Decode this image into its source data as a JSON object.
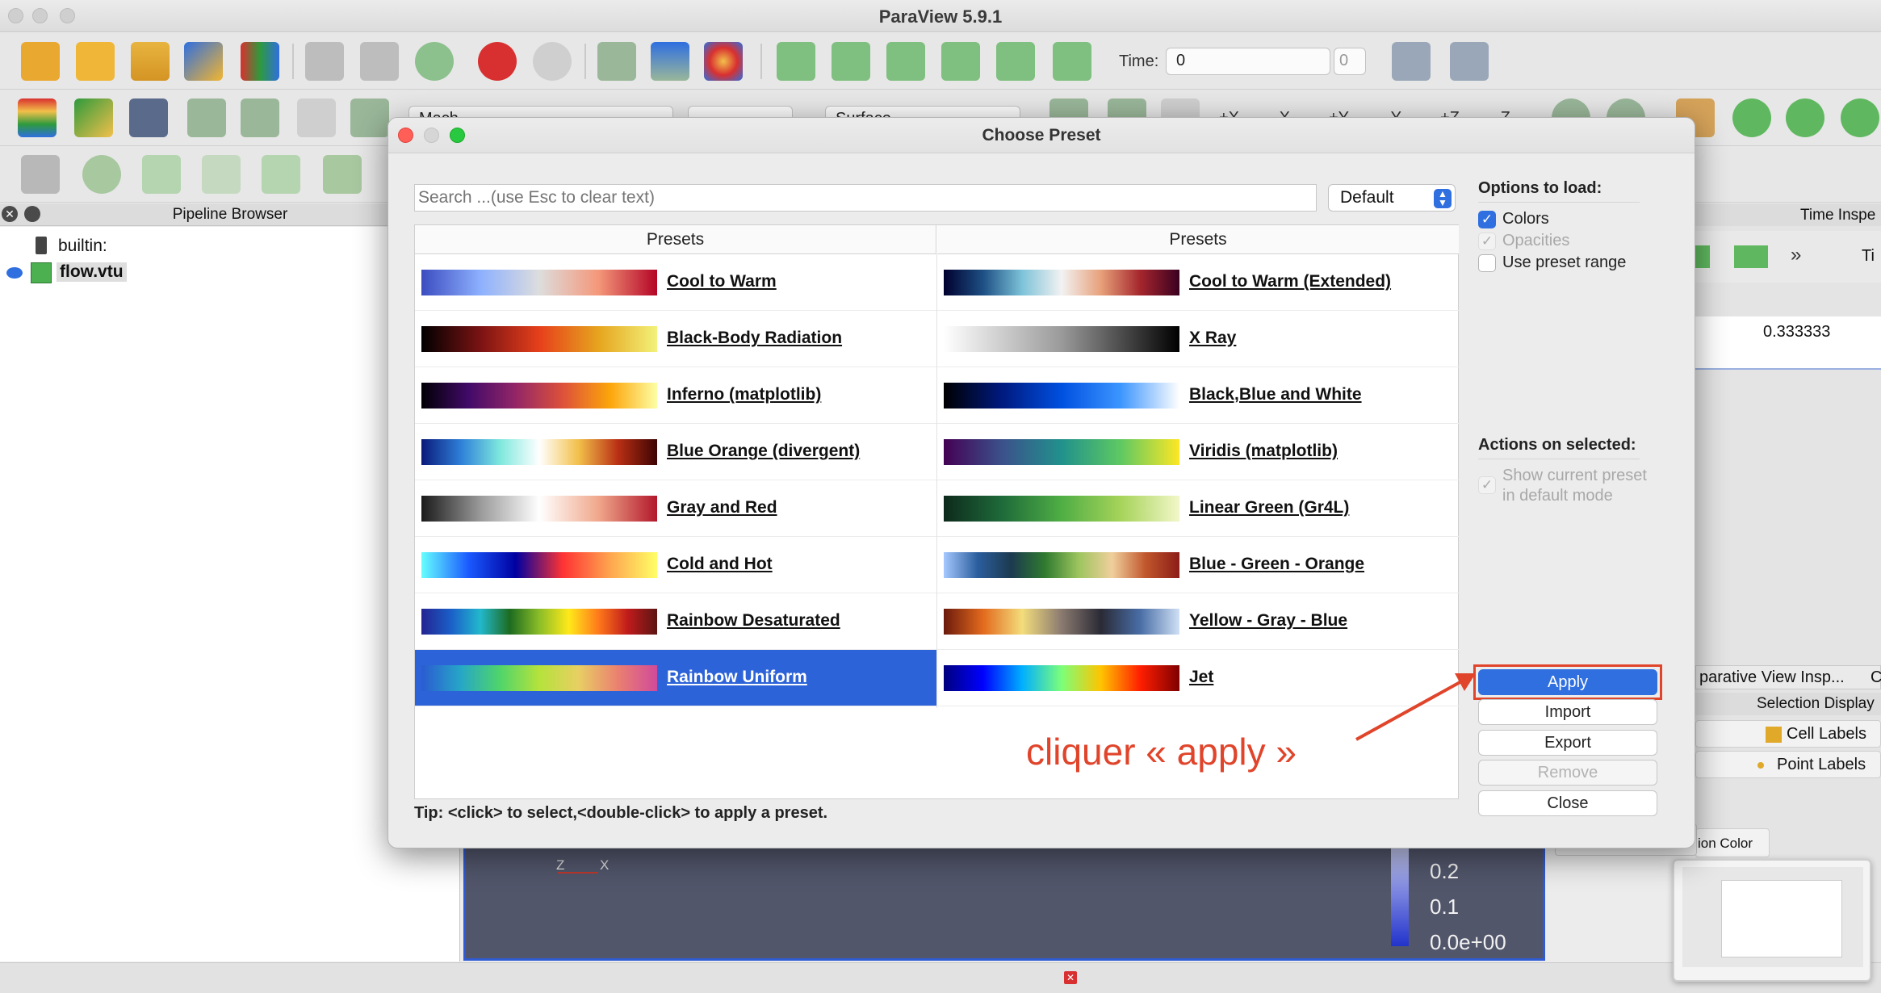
{
  "window": {
    "title": "ParaView 5.9.1"
  },
  "toolbar": {
    "time_label": "Time:",
    "time_value": "0",
    "time_index": "0",
    "array_combo": "Mach",
    "representation_combo": "Surface",
    "camera_labels": [
      "+X",
      "-X",
      "+Y",
      "-Y",
      "+Z",
      "-Z"
    ]
  },
  "pipeline": {
    "header": "Pipeline Browser",
    "items": [
      {
        "label": "builtin:"
      },
      {
        "label": "flow.vtu"
      }
    ]
  },
  "right_panel": {
    "time_inspector": "Time Inspe",
    "time_short": "Ti",
    "time_value": "0.333333",
    "comparative_tab": "parative View Insp...",
    "other_tab": "C",
    "selection_display": "Selection Display",
    "cell_labels": "Cell Labels",
    "point_labels": "Point Labels",
    "color_label": "ion Color"
  },
  "render_view": {
    "scalar_labels": [
      "0.2",
      "0.1",
      "0.0e+00"
    ],
    "axes_z": "Z",
    "axes_x": "X"
  },
  "dialog": {
    "title": "Choose Preset",
    "search_placeholder": "Search ...(use Esc to clear text)",
    "filter_value": "Default",
    "column_headers": [
      "Presets",
      "Presets"
    ],
    "left_presets": [
      {
        "name": "Cool to Warm",
        "colors": [
          "#3b4cc0",
          "#8db0fe",
          "#dddddd",
          "#f4987a",
          "#b40426"
        ]
      },
      {
        "name": "Black-Body Radiation",
        "colors": [
          "#000000",
          "#7a1313",
          "#e6401b",
          "#e6a41e",
          "#f2f27a"
        ]
      },
      {
        "name": "Inferno (matplotlib)",
        "colors": [
          "#000004",
          "#420a68",
          "#932667",
          "#dd513a",
          "#fca50a",
          "#fcffa4"
        ]
      },
      {
        "name": "Blue Orange (divergent)",
        "colors": [
          "#0a1a7a",
          "#2e7fd8",
          "#7ee8dd",
          "#ffffff",
          "#f2c04a",
          "#b93014",
          "#3d0303"
        ]
      },
      {
        "name": "Gray and Red",
        "colors": [
          "#1a1a1a",
          "#9a9a9a",
          "#ffffff",
          "#f0a88c",
          "#b2182b"
        ]
      },
      {
        "name": "Cold and Hot",
        "colors": [
          "#66ffff",
          "#1a5aff",
          "#0000a0",
          "#ff3333",
          "#ffa54f",
          "#ffff66"
        ]
      },
      {
        "name": "Rainbow Desaturated",
        "colors": [
          "#242491",
          "#1a5fc8",
          "#22b8cc",
          "#1d6b20",
          "#8bbd28",
          "#ffe91a",
          "#ff7a1a",
          "#c01b1b",
          "#5c1414"
        ]
      },
      {
        "name": "Rainbow Uniform",
        "colors": [
          "#2a5bd1",
          "#26a6c7",
          "#4fd56a",
          "#b5e23c",
          "#e8cf63",
          "#ea8070",
          "#d14a9a"
        ]
      }
    ],
    "right_presets": [
      {
        "name": "Cool to Warm (Extended)",
        "colors": [
          "#00002e",
          "#1d4f84",
          "#7ec3d9",
          "#f2f2f2",
          "#e7a17a",
          "#a5262d",
          "#3a0020"
        ]
      },
      {
        "name": "X Ray",
        "colors": [
          "#ffffff",
          "#9a9a9a",
          "#000000"
        ]
      },
      {
        "name": "Black,Blue and White",
        "colors": [
          "#000000",
          "#001a80",
          "#0050e0",
          "#3c96ff",
          "#ffffff"
        ]
      },
      {
        "name": "Viridis (matplotlib)",
        "colors": [
          "#440154",
          "#3b528b",
          "#21918c",
          "#5ec962",
          "#fde725"
        ]
      },
      {
        "name": "Linear Green (Gr4L)",
        "colors": [
          "#0d2a1c",
          "#1f6b3a",
          "#4fae44",
          "#a6d35a",
          "#f2f7c8"
        ]
      },
      {
        "name": "Blue - Green - Orange",
        "colors": [
          "#a5c8ff",
          "#2b5e9e",
          "#1c3a4f",
          "#2f7a2f",
          "#9cc55e",
          "#efcf9c",
          "#c0562c",
          "#8c1c18"
        ]
      },
      {
        "name": "Yellow - Gray - Blue",
        "colors": [
          "#6b1a0c",
          "#e36a1d",
          "#f3dd7c",
          "#8a7a70",
          "#2a2a35",
          "#496ea6",
          "#cfe0f5"
        ]
      },
      {
        "name": "Jet",
        "colors": [
          "#00007f",
          "#0000ff",
          "#00b0ff",
          "#7cff79",
          "#ffc400",
          "#ff1e00",
          "#7f0000"
        ]
      }
    ],
    "selected_preset": "Rainbow Uniform",
    "tip": "Tip: <click> to select,<double-click> to apply a preset.",
    "options_title": "Options to load:",
    "options": [
      {
        "label": "Colors",
        "checked": true,
        "enabled": true
      },
      {
        "label": "Opacities",
        "checked": true,
        "enabled": false
      },
      {
        "label": "Use preset range",
        "checked": false,
        "enabled": true
      }
    ],
    "actions_title": "Actions on selected:",
    "show_current_line1": "Show current preset",
    "show_current_line2": "in default mode",
    "buttons": {
      "apply": "Apply",
      "import": "Import",
      "export": "Export",
      "remove": "Remove",
      "close": "Close"
    }
  },
  "annotation": {
    "text": "cliquer « apply »",
    "color": "#e0452b"
  },
  "colors": {
    "accent": "#2f6fe0",
    "selection": "#2c63d8",
    "annotation": "#e0452b"
  }
}
